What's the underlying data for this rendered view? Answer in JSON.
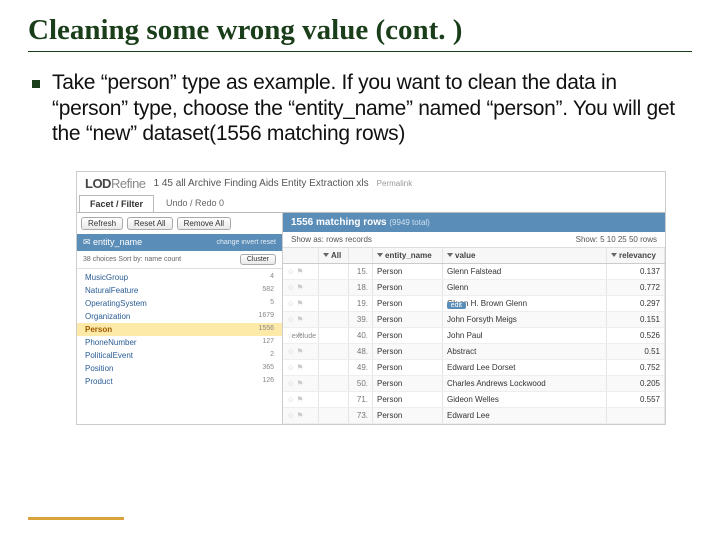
{
  "title": "Cleaning some wrong value (cont. )",
  "body": "Take “person” type as example. If you want to clean the data in “person” type, choose the “entity_name” named “person”. You will get the “new” dataset(1556 matching rows)",
  "app": {
    "brand_prefix": "LOD",
    "brand_suffix": "Refine",
    "file_title": "1 45 all Archive Finding Aids Entity Extraction xls",
    "permalink": "Permalink",
    "tabs": {
      "facet": "Facet / Filter",
      "undo": "Undo / Redo 0"
    },
    "left_actions": {
      "refresh": "Refresh",
      "reset": "Reset All",
      "remove": "Remove All"
    },
    "facet": {
      "name": "entity_name",
      "controls": "change invert reset",
      "choices": "38 choices",
      "sort": "Sort by: name  count",
      "cluster": "Cluster",
      "items": [
        {
          "name": "MusicGroup",
          "count": "4"
        },
        {
          "name": "NaturalFeature",
          "count": "582"
        },
        {
          "name": "OperatingSystem",
          "count": "5"
        },
        {
          "name": "Organization",
          "count": "1679"
        },
        {
          "name": "Person",
          "count": "1556",
          "selected": true
        },
        {
          "name": "PhoneNumber",
          "count": "127"
        },
        {
          "name": "PoliticalEvent",
          "count": "2"
        },
        {
          "name": "Position",
          "count": "365"
        },
        {
          "name": "Product",
          "count": "126"
        }
      ],
      "edit": "edit",
      "exclude": "exclude"
    },
    "grid": {
      "header": "1556 matching rows",
      "total": "(9949 total)",
      "showas": "Show as:  rows  records",
      "showcount": "Show:  5  10  25  50  rows",
      "columns": {
        "all": "All",
        "entity": "entity_name",
        "value": "value",
        "relevancy": "relevancy"
      },
      "rows": [
        {
          "idx": "15.",
          "ent": "Person",
          "val": "Glenn Falstead",
          "rel": "0.137"
        },
        {
          "idx": "18.",
          "ent": "Person",
          "val": "Glenn",
          "rel": "0.772"
        },
        {
          "idx": "19.",
          "ent": "Person",
          "val": "Glenn H. Brown Glenn",
          "rel": "0.297"
        },
        {
          "idx": "39.",
          "ent": "Person",
          "val": "John Forsyth Meigs",
          "rel": "0.151"
        },
        {
          "idx": "40.",
          "ent": "Person",
          "val": "John Paul",
          "rel": "0.526"
        },
        {
          "idx": "48.",
          "ent": "Person",
          "val": "Abstract",
          "rel": "0.51"
        },
        {
          "idx": "49.",
          "ent": "Person",
          "val": "Edward Lee Dorset",
          "rel": "0.752"
        },
        {
          "idx": "50.",
          "ent": "Person",
          "val": "Charles Andrews Lockwood",
          "rel": "0.205"
        },
        {
          "idx": "71.",
          "ent": "Person",
          "val": "Gideon Welles",
          "rel": "0.557"
        },
        {
          "idx": "73.",
          "ent": "Person",
          "val": "Edward Lee",
          "rel": ""
        }
      ]
    }
  }
}
